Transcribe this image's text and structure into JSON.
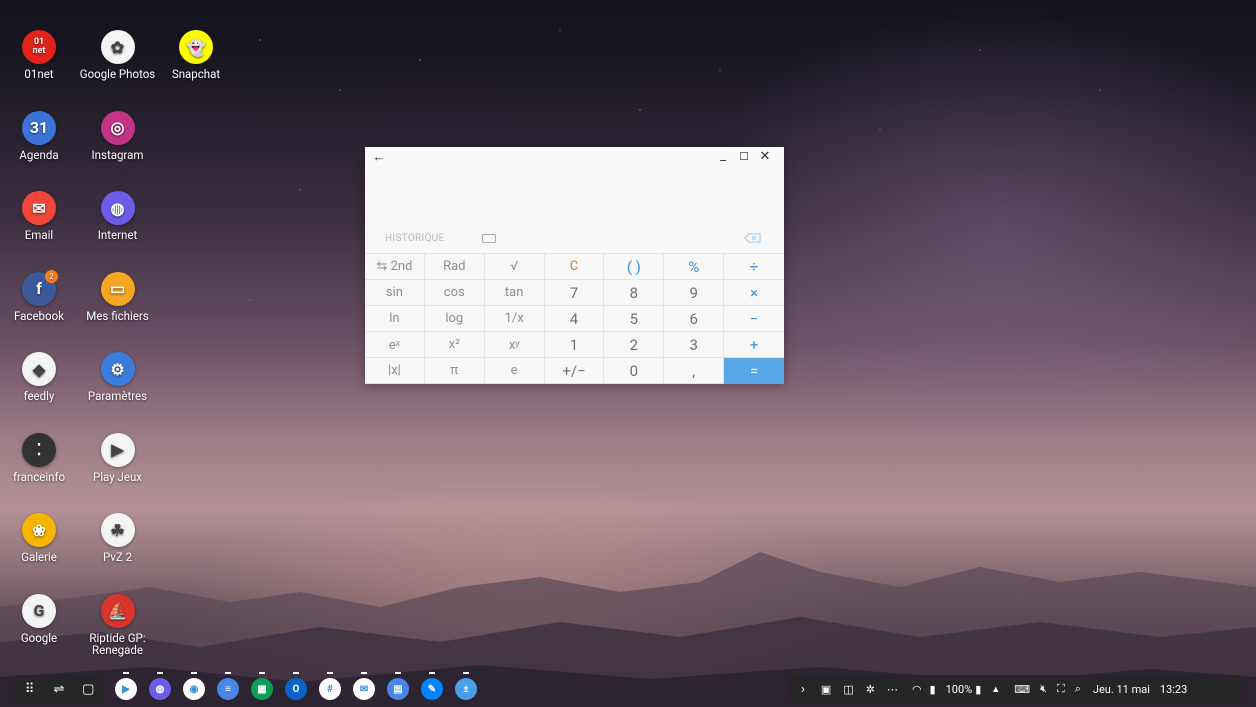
{
  "desktop_icons": [
    {
      "label": "01net",
      "color": "#e2231a",
      "glyph": "01\nnet",
      "badge": ""
    },
    {
      "label": "Google Photos",
      "color": "#f4f4f4",
      "glyph": "✿",
      "badge": ""
    },
    {
      "label": "Snapchat",
      "color": "#fffc00",
      "glyph": "👻",
      "badge": ""
    },
    {
      "label": "Agenda",
      "color": "#3b73d9",
      "glyph": "31",
      "badge": ""
    },
    {
      "label": "Instagram",
      "color": "#c13584",
      "glyph": "◎",
      "badge": ""
    },
    {
      "label": "Email",
      "color": "#f0463a",
      "glyph": "✉",
      "badge": ""
    },
    {
      "label": "Internet",
      "color": "#6c5ce7",
      "glyph": "◍",
      "badge": ""
    },
    {
      "label": "Facebook",
      "color": "#3b5998",
      "glyph": "f",
      "badge": "2"
    },
    {
      "label": "Mes fichiers",
      "color": "#f5a623",
      "glyph": "▭",
      "badge": ""
    },
    {
      "label": "feedly",
      "color": "#f4f4f4",
      "glyph": "◆",
      "badge": ""
    },
    {
      "label": "Paramètres",
      "color": "#3b7ddd",
      "glyph": "⚙",
      "badge": ""
    },
    {
      "label": "franceinfo",
      "color": "#333333",
      "glyph": "⁚",
      "badge": ""
    },
    {
      "label": "Play Jeux",
      "color": "#f4f4f4",
      "glyph": "▶",
      "badge": ""
    },
    {
      "label": "Galerie",
      "color": "#f7b500",
      "glyph": "❀",
      "badge": ""
    },
    {
      "label": "PvZ 2",
      "color": "#f4f4f4",
      "glyph": "☘",
      "badge": ""
    },
    {
      "label": "Google",
      "color": "#f4f4f4",
      "glyph": "G",
      "badge": ""
    },
    {
      "label": "Riptide GP:\nRenegade",
      "color": "#d9352f",
      "glyph": "⛵",
      "badge": ""
    }
  ],
  "calculator": {
    "history_label": "HISTORIQUE",
    "keys": [
      "⇆ 2nd",
      "Rad",
      "√",
      "C",
      "( )",
      "%",
      "÷",
      "sin",
      "cos",
      "tan",
      "7",
      "8",
      "9",
      "×",
      "ln",
      "log",
      "1/x",
      "4",
      "5",
      "6",
      "−",
      "eˣ",
      "x²",
      "xʸ",
      "1",
      "2",
      "3",
      "+",
      "|x|",
      "π",
      "e",
      "+/−",
      "0",
      ",",
      "="
    ]
  },
  "taskbar": {
    "left_buttons": [
      "⠿",
      "⇌",
      "▢"
    ],
    "dock_apps": [
      {
        "name": "play-store",
        "color": "#ffffff",
        "glyph": "▶"
      },
      {
        "name": "samsung-internet",
        "color": "#6c5ce7",
        "glyph": "◍"
      },
      {
        "name": "chrome",
        "color": "#ffffff",
        "glyph": "◉"
      },
      {
        "name": "docs",
        "color": "#4a86e8",
        "glyph": "≡"
      },
      {
        "name": "sheets",
        "color": "#0f9d58",
        "glyph": "▦"
      },
      {
        "name": "outlook",
        "color": "#0a64c8",
        "glyph": "O"
      },
      {
        "name": "slack",
        "color": "#ffffff",
        "glyph": "#"
      },
      {
        "name": "mail",
        "color": "#ffffff",
        "glyph": "✉"
      },
      {
        "name": "files",
        "color": "#4a86e8",
        "glyph": "▤"
      },
      {
        "name": "messenger",
        "color": "#0084ff",
        "glyph": "✎"
      },
      {
        "name": "calculator",
        "color": "#4a9fe8",
        "glyph": "±"
      }
    ],
    "tray": {
      "battery": "100%",
      "date": "Jeu. 11 mai",
      "time": "13:23"
    }
  }
}
